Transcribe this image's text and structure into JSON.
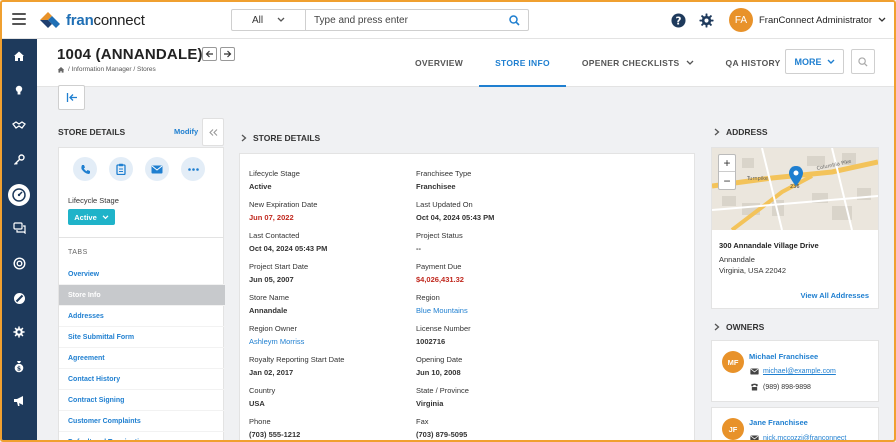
{
  "app": {
    "logo_text_brand": "fran",
    "logo_text_rest": "connect",
    "search_scope": "All",
    "search_placeholder": "Type and press enter",
    "user_initials": "FA",
    "user_name": "FranConnect Administrator"
  },
  "nav_icons": [
    "home-icon",
    "lightbulb-icon",
    "handshake-icon",
    "key-icon",
    "dashboard-icon",
    "chat-icon",
    "support-icon",
    "ban-icon",
    "gear-icon",
    "money-bag-icon",
    "megaphone-icon"
  ],
  "header": {
    "title": "1004 (ANNANDALE)",
    "breadcrumb": "/ Information Manager / Stores",
    "tabs": [
      {
        "label": "OVERVIEW",
        "active": false,
        "dropdown": false
      },
      {
        "label": "STORE INFO",
        "active": true,
        "dropdown": false
      },
      {
        "label": "OPENER CHECKLISTS",
        "active": false,
        "dropdown": true
      },
      {
        "label": "QA HISTORY",
        "active": false,
        "dropdown": false
      }
    ],
    "more_label": "MORE"
  },
  "store_details_panel": {
    "heading": "STORE DETAILS",
    "modify_label": "Modify",
    "lifecycle_label": "Lifecycle Stage",
    "lifecycle_value": "Active",
    "tabs_heading": "TABS",
    "tab_items": [
      {
        "label": "Overview",
        "active": false
      },
      {
        "label": "Store Info",
        "active": true
      },
      {
        "label": "Addresses",
        "active": false
      },
      {
        "label": "Site Submittal Form",
        "active": false
      },
      {
        "label": "Agreement",
        "active": false
      },
      {
        "label": "Contact History",
        "active": false
      },
      {
        "label": "Contract Signing",
        "active": false
      },
      {
        "label": "Customer Complaints",
        "active": false
      },
      {
        "label": "Default and Termination",
        "active": false
      }
    ]
  },
  "details": {
    "heading": "STORE DETAILS",
    "fields": [
      {
        "label": "Lifecycle Stage",
        "value": "Active",
        "style": "bold"
      },
      {
        "label": "Franchisee Type",
        "value": "Franchisee",
        "style": "bold"
      },
      {
        "label": "New Expiration Date",
        "value": "Jun 07, 2022",
        "style": "red"
      },
      {
        "label": "Last Updated On",
        "value": "Oct 04, 2024 05:43 PM",
        "style": "bold"
      },
      {
        "label": "Last Contacted",
        "value": "Oct 04, 2024 05:43 PM",
        "style": "bold"
      },
      {
        "label": "Project Status",
        "value": "--",
        "style": "bold"
      },
      {
        "label": "Project Start Date",
        "value": "Jun 05, 2007",
        "style": "bold"
      },
      {
        "label": "Payment Due",
        "value": "$4,026,431.32",
        "style": "red"
      },
      {
        "label": "Store Name",
        "value": "Annandale",
        "style": "bold"
      },
      {
        "label": "Region",
        "value": "Blue Mountains",
        "style": "link"
      },
      {
        "label": "Region Owner",
        "value": "Ashleym Morriss",
        "style": "link"
      },
      {
        "label": "License Number",
        "value": "1002716",
        "style": "bold"
      },
      {
        "label": "Royalty Reporting Start Date",
        "value": "Jan 02, 2017",
        "style": "bold"
      },
      {
        "label": "Opening Date",
        "value": "Jun 10, 2008",
        "style": "bold"
      },
      {
        "label": "Country",
        "value": "USA",
        "style": "bold"
      },
      {
        "label": "State / Province",
        "value": "Virginia",
        "style": "bold"
      },
      {
        "label": "Phone",
        "value": "(703) 555-1212",
        "style": "bold"
      },
      {
        "label": "Fax",
        "value": "(703) 879-5095",
        "style": "bold"
      }
    ]
  },
  "address": {
    "heading": "ADDRESS",
    "map_labels": [
      "Columbia Pike",
      "Turnpike",
      "236"
    ],
    "line1": "300 Annandale Village Drive",
    "line2": "Annandale",
    "line3": "Virginia, USA 22042",
    "view_all": "View All Addresses"
  },
  "owners": {
    "heading": "OWNERS",
    "list": [
      {
        "initials": "MF",
        "name": "Michael Franchisee",
        "email": "michael@example.com",
        "phone": "(989) 898-9898"
      },
      {
        "initials": "JF",
        "name": "Jane Franchisee",
        "email": "nick.mccozzi@franconnect",
        "phone": ""
      }
    ]
  },
  "colors": {
    "accent": "#1f7fd0",
    "nav": "#1e3a5c",
    "avatar": "#e8922a",
    "pill": "#1fb3c9",
    "alert": "#c0281e"
  }
}
